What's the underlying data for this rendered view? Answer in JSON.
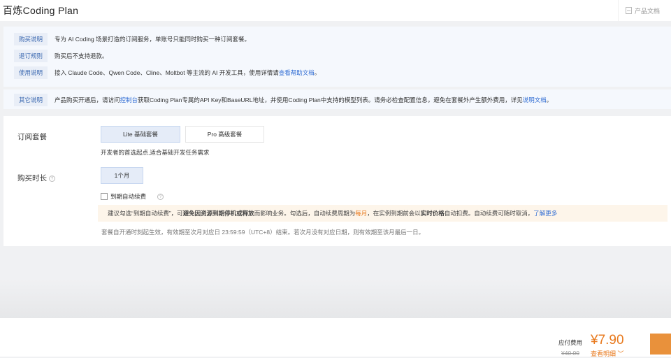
{
  "header": {
    "title": "百炼Coding Plan",
    "docs_label": "产品文档"
  },
  "info": [
    {
      "tag": "购买说明",
      "text": "专为 AI Coding 场景打造的订阅服务，单账号只能同时购买一种订阅套餐。"
    },
    {
      "tag": "退订规则",
      "text": "购买后不支持退款。"
    },
    {
      "tag": "使用说明",
      "text": "接入 Claude Code、Qwen Code、Cline、Moltbot 等主流的 AI 开发工具，使用详情请",
      "link": "查看帮助文档",
      "suffix": "。"
    }
  ],
  "other": {
    "tag": "其它说明",
    "pre": "产品购买开通后，请访问",
    "link1": "控制台",
    "mid": "获取Coding Plan专属的API Key和BaseURL地址，并使用Coding Plan中支持的模型列表。请务必检查配置信息，避免在套餐外产生额外费用，详见",
    "link2": "说明文档",
    "suffix": "。"
  },
  "plan": {
    "label": "订阅套餐",
    "options": [
      "Lite 基础套餐",
      "Pro 高级套餐"
    ],
    "selected": "Lite 基础套餐",
    "description": "开发者的首选起点,适合基础开发任务需求"
  },
  "duration": {
    "label": "购买时长",
    "help": "?",
    "options": [
      "1个月"
    ],
    "selected": "1个月"
  },
  "auto_renew": {
    "label": "到期自动续费",
    "checked": false,
    "help": "?"
  },
  "notice": {
    "p1": "建议勾选“到期自动续费”，可",
    "b1": "避免因资源到期停机或释放",
    "p2": "而影响业务。勾选后，自动续费周期为 ",
    "period": "每月",
    "p3": "，在实例到期前会以",
    "b2": "实时价格",
    "p4": "自动扣费。自动续费可随时取消，",
    "link": "了解更多"
  },
  "validity": "套餐自开通时刻起生效，有效期至次月对应日 23:59:59（UTC+8）结束。若次月没有对应日期，则有效期至该月最后一日。",
  "footer": {
    "label": "应付费用",
    "price": "¥7.90",
    "original": "¥40.00",
    "details": "查看明细"
  },
  "colors": {
    "accent": "#e8791d",
    "link": "#2e6bd3"
  }
}
